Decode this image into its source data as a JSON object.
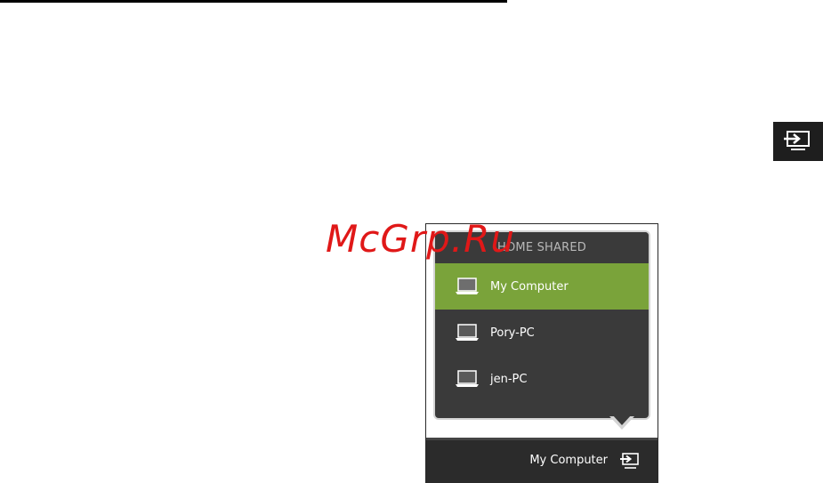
{
  "watermark": "McGrp.Ru",
  "icons": {
    "standalone": "media-play-to-icon",
    "laptop": "laptop-icon",
    "taskbar": "media-play-to-icon"
  },
  "popup": {
    "header": "HOME SHARED",
    "devices": [
      {
        "label": "My Computer",
        "selected": true
      },
      {
        "label": "Pory-PC",
        "selected": false
      },
      {
        "label": "jen-PC",
        "selected": false
      }
    ]
  },
  "taskbar": {
    "label": "My Computer"
  },
  "colors": {
    "selected": "#7aa33a",
    "popup_bg": "#3a3a3a",
    "taskbar_bg": "#2b2b2b",
    "watermark": "#e01818"
  }
}
